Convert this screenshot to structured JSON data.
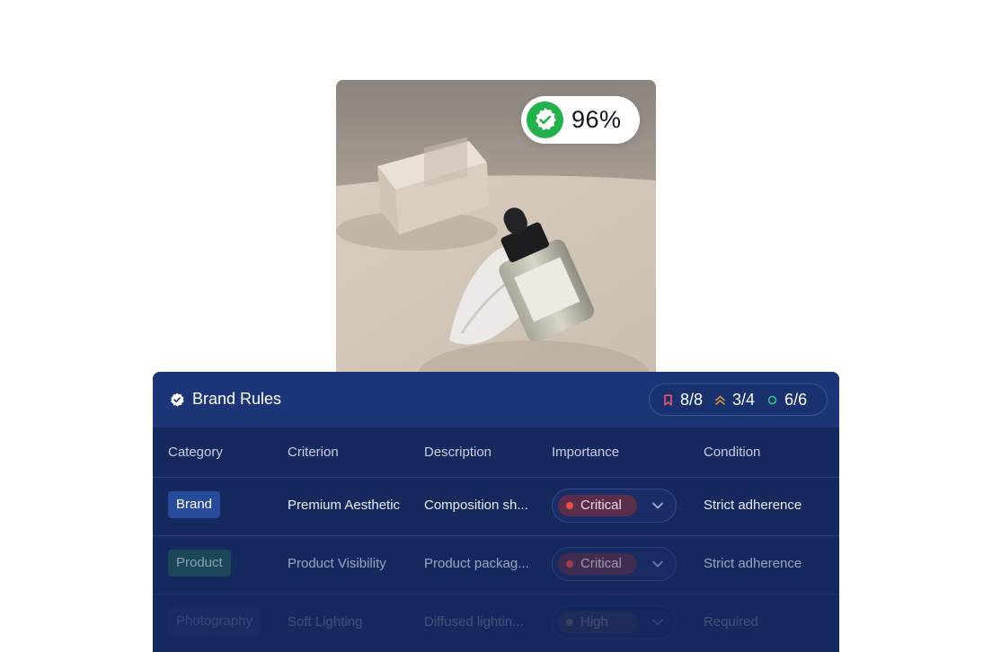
{
  "score": {
    "value": "96%",
    "icon": "badge-check-icon",
    "color": "#22b14c"
  },
  "panel": {
    "title": "Brand Rules",
    "stats": [
      {
        "icon": "bookmark-icon",
        "value": "8/8",
        "color": "#ff5a6a"
      },
      {
        "icon": "double-chevron-up-icon",
        "value": "3/4",
        "color": "#f0a23a"
      },
      {
        "icon": "circle-icon",
        "value": "6/6",
        "color": "#2fd27a"
      }
    ],
    "columns": [
      "Category",
      "Criterion",
      "Description",
      "Importance",
      "Condition"
    ],
    "rows": [
      {
        "category": "Brand",
        "criterion": "Premium Aesthetic",
        "description": "Composition sh...",
        "importance": "Critical",
        "condition": "Strict adherence"
      },
      {
        "category": "Product",
        "criterion": "Product Visibility",
        "description": "Product packag...",
        "importance": "Critical",
        "condition": "Strict adherence"
      },
      {
        "category": "Photography",
        "criterion": "Soft Lighting",
        "description": "Diffused lightin...",
        "importance": "High",
        "condition": "Required"
      }
    ]
  }
}
